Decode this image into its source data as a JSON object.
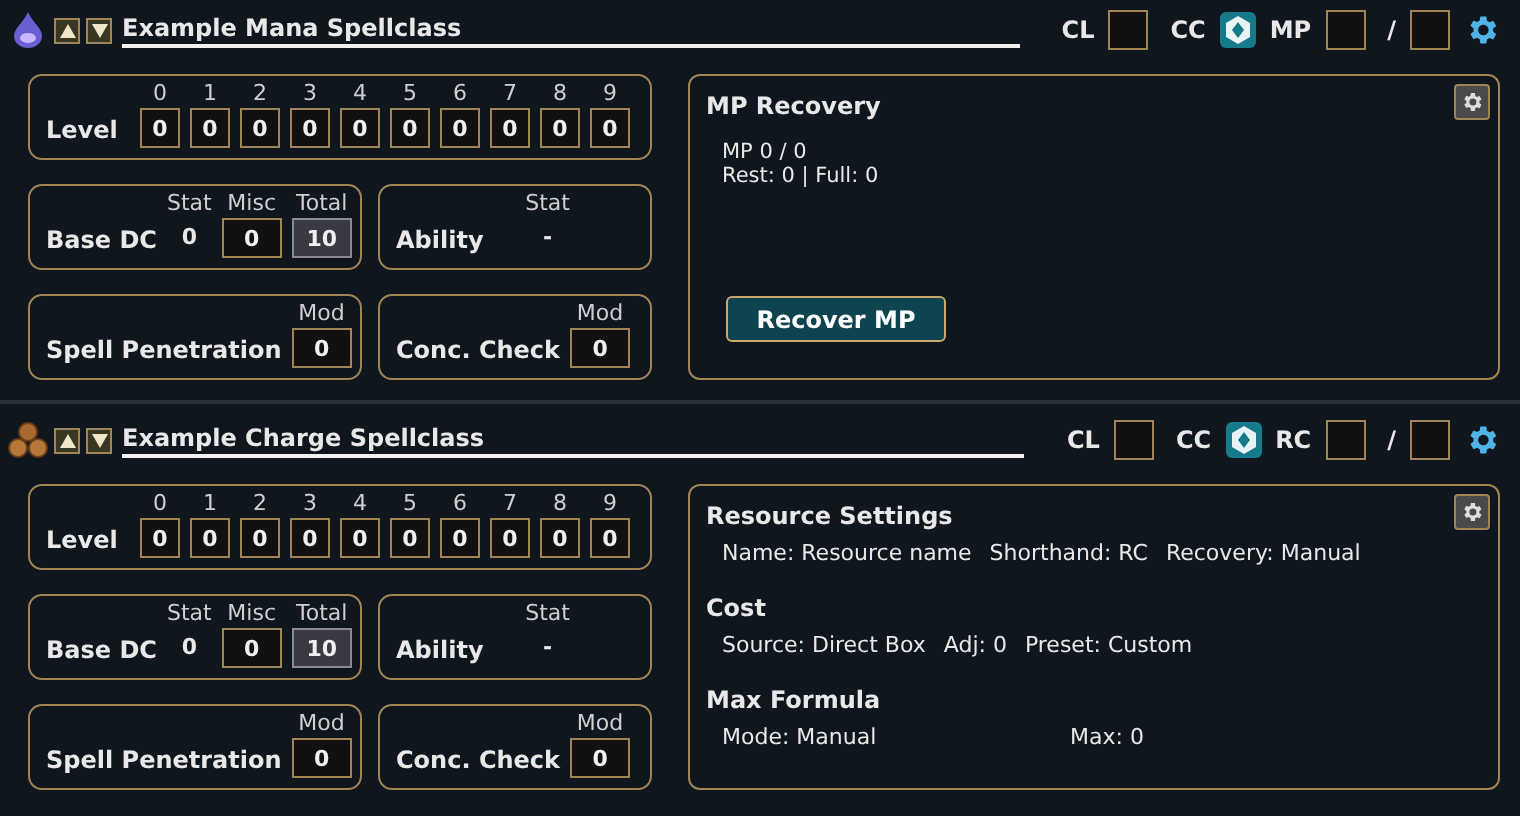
{
  "sections": [
    {
      "kind": "mana",
      "title": "Example Mana Spellclass",
      "cl_label": "CL",
      "cc_label": "CC",
      "resource_label": "MP",
      "separator": "/",
      "levels": {
        "label": "Level",
        "columns": [
          "0",
          "1",
          "2",
          "3",
          "4",
          "5",
          "6",
          "7",
          "8",
          "9"
        ],
        "values": [
          "0",
          "0",
          "0",
          "0",
          "0",
          "0",
          "0",
          "0",
          "0",
          "0"
        ]
      },
      "base_dc": {
        "label": "Base DC",
        "headers": [
          "Stat",
          "Misc",
          "Total"
        ],
        "stat": "0",
        "misc": "0",
        "total": "10"
      },
      "ability": {
        "label": "Ability",
        "header": "Stat",
        "value": "-"
      },
      "spell_penetration": {
        "label": "Spell Penetration",
        "header": "Mod",
        "value": "0"
      },
      "conc_check": {
        "label": "Conc. Check",
        "header": "Mod",
        "value": "0"
      },
      "panel": {
        "kind": "recovery",
        "title": "MP Recovery",
        "lines": [
          "MP 0 / 0",
          "Rest: 0 | Full: 0"
        ],
        "button": "Recover MP"
      }
    },
    {
      "kind": "charge",
      "title": "Example Charge Spellclass",
      "cl_label": "CL",
      "cc_label": "CC",
      "resource_label": "RC",
      "separator": "/",
      "levels": {
        "label": "Level",
        "columns": [
          "0",
          "1",
          "2",
          "3",
          "4",
          "5",
          "6",
          "7",
          "8",
          "9"
        ],
        "values": [
          "0",
          "0",
          "0",
          "0",
          "0",
          "0",
          "0",
          "0",
          "0",
          "0"
        ]
      },
      "base_dc": {
        "label": "Base DC",
        "headers": [
          "Stat",
          "Misc",
          "Total"
        ],
        "stat": "0",
        "misc": "0",
        "total": "10"
      },
      "ability": {
        "label": "Ability",
        "header": "Stat",
        "value": "-"
      },
      "spell_penetration": {
        "label": "Spell Penetration",
        "header": "Mod",
        "value": "0"
      },
      "conc_check": {
        "label": "Conc. Check",
        "header": "Mod",
        "value": "0"
      },
      "panel": {
        "kind": "settings",
        "groups": [
          {
            "title": "Resource Settings",
            "items": [
              "Name: Resource name",
              "Shorthand: RC",
              "Recovery: Manual"
            ]
          },
          {
            "title": "Cost",
            "items": [
              "Source: Direct Box",
              "Adj: 0",
              "Preset: Custom"
            ]
          },
          {
            "title": "Max Formula",
            "items": [
              "Mode: Manual",
              "Max: 0"
            ]
          }
        ]
      }
    }
  ]
}
